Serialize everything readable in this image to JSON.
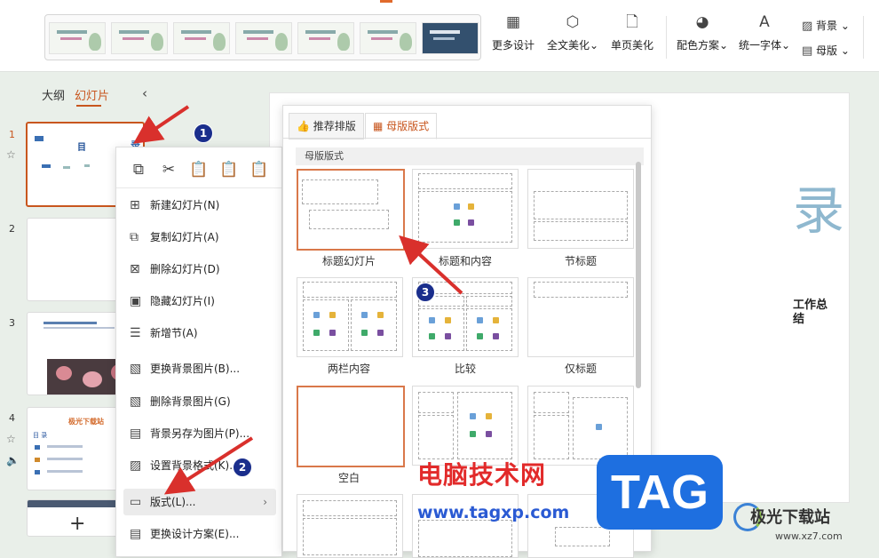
{
  "ribbon": {
    "gallery_count": 7,
    "buttons": [
      {
        "label": "更多设计",
        "icon": "grid-icon"
      },
      {
        "label": "全文美化",
        "icon": "cube-icon"
      },
      {
        "label": "单页美化",
        "icon": "page-sparkle-icon"
      },
      {
        "label": "配色方案",
        "icon": "palette-icon"
      },
      {
        "label": "统一字体",
        "icon": "font-icon"
      }
    ],
    "small_buttons": [
      {
        "label": "背景",
        "icon": "background-icon"
      },
      {
        "label": "母版",
        "icon": "master-icon"
      }
    ]
  },
  "left_panel": {
    "tabs": [
      "大纲",
      "幻灯片"
    ],
    "active_tab": "幻灯片",
    "collapse_glyph": "‹",
    "slides": [
      {
        "num": "1",
        "thumb_title": "目",
        "thumb_char": "录"
      },
      {
        "num": "2"
      },
      {
        "num": "3"
      },
      {
        "num": "4",
        "thumb_title": "极光下载站",
        "thumb_sub": "目 录"
      }
    ],
    "add_glyph": "+"
  },
  "canvas": {
    "big_char": "录",
    "title": "工作总结"
  },
  "context_menu": {
    "top_icons": [
      "copy-icon",
      "cut-icon",
      "paste-icon",
      "paste-text-icon",
      "paste-special-icon"
    ],
    "items": [
      {
        "label": "新建幻灯片(N)",
        "icon": "new-slide-icon"
      },
      {
        "label": "复制幻灯片(A)",
        "icon": "duplicate-slide-icon"
      },
      {
        "label": "删除幻灯片(D)",
        "icon": "delete-slide-icon"
      },
      {
        "label": "隐藏幻灯片(I)",
        "icon": "hide-slide-icon"
      },
      {
        "label": "新增节(A)",
        "icon": "new-section-icon"
      },
      {
        "label": "更换背景图片(B)...",
        "icon": "change-bg-icon"
      },
      {
        "label": "删除背景图片(G)",
        "icon": "delete-bg-icon"
      },
      {
        "label": "背景另存为图片(P)...",
        "icon": "save-bg-icon"
      },
      {
        "label": "设置背景格式(K)...",
        "icon": "bg-format-icon"
      },
      {
        "label": "版式(L)...",
        "icon": "layout-icon",
        "highlighted": true
      },
      {
        "label": "更换设计方案(E)...",
        "icon": "design-scheme-icon"
      }
    ]
  },
  "layout_panel": {
    "tabs": [
      "推荐排版",
      "母版版式"
    ],
    "active_tab": "母版版式",
    "section_title": "母版版式",
    "layouts": [
      "标题幻灯片",
      "标题和内容",
      "节标题",
      "两栏内容",
      "比较",
      "仅标题",
      "空白",
      "",
      ""
    ],
    "selected_layout": "标题幻灯片"
  },
  "annotations": [
    "1",
    "2",
    "3"
  ],
  "watermark": {
    "cn": "电脑技术网",
    "url": "www.tagxp.com",
    "tag": "TAG",
    "brand": "极光下载站",
    "brand_url": "www.xz7.com"
  },
  "colors": {
    "accent": "#c8561e",
    "arrow": "#d9302c",
    "badge": "#1a2e8c",
    "tag_blue": "#1e6fe0"
  }
}
